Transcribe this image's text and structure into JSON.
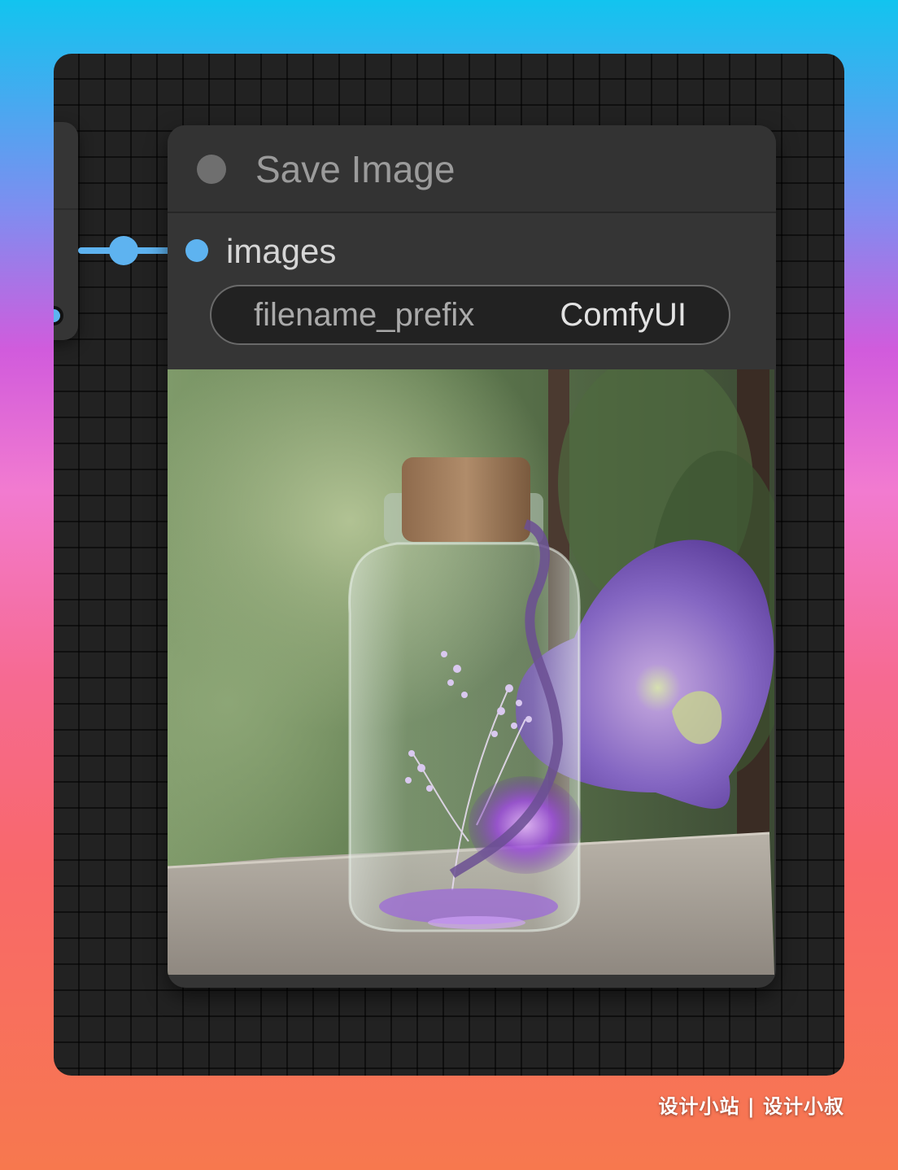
{
  "node": {
    "title": "Save Image",
    "input_label": "images",
    "widget": {
      "name": "filename_prefix",
      "value": "ComfyUI"
    }
  },
  "preview": {
    "alt": "Glass bottle with cork containing purple flowers beside a large purple flower on a wooden table"
  },
  "watermark": "设计小站 | 设计小叔",
  "colors": {
    "link": "#5eb3f0",
    "node_bg": "#353535",
    "canvas_bg": "#222222"
  }
}
